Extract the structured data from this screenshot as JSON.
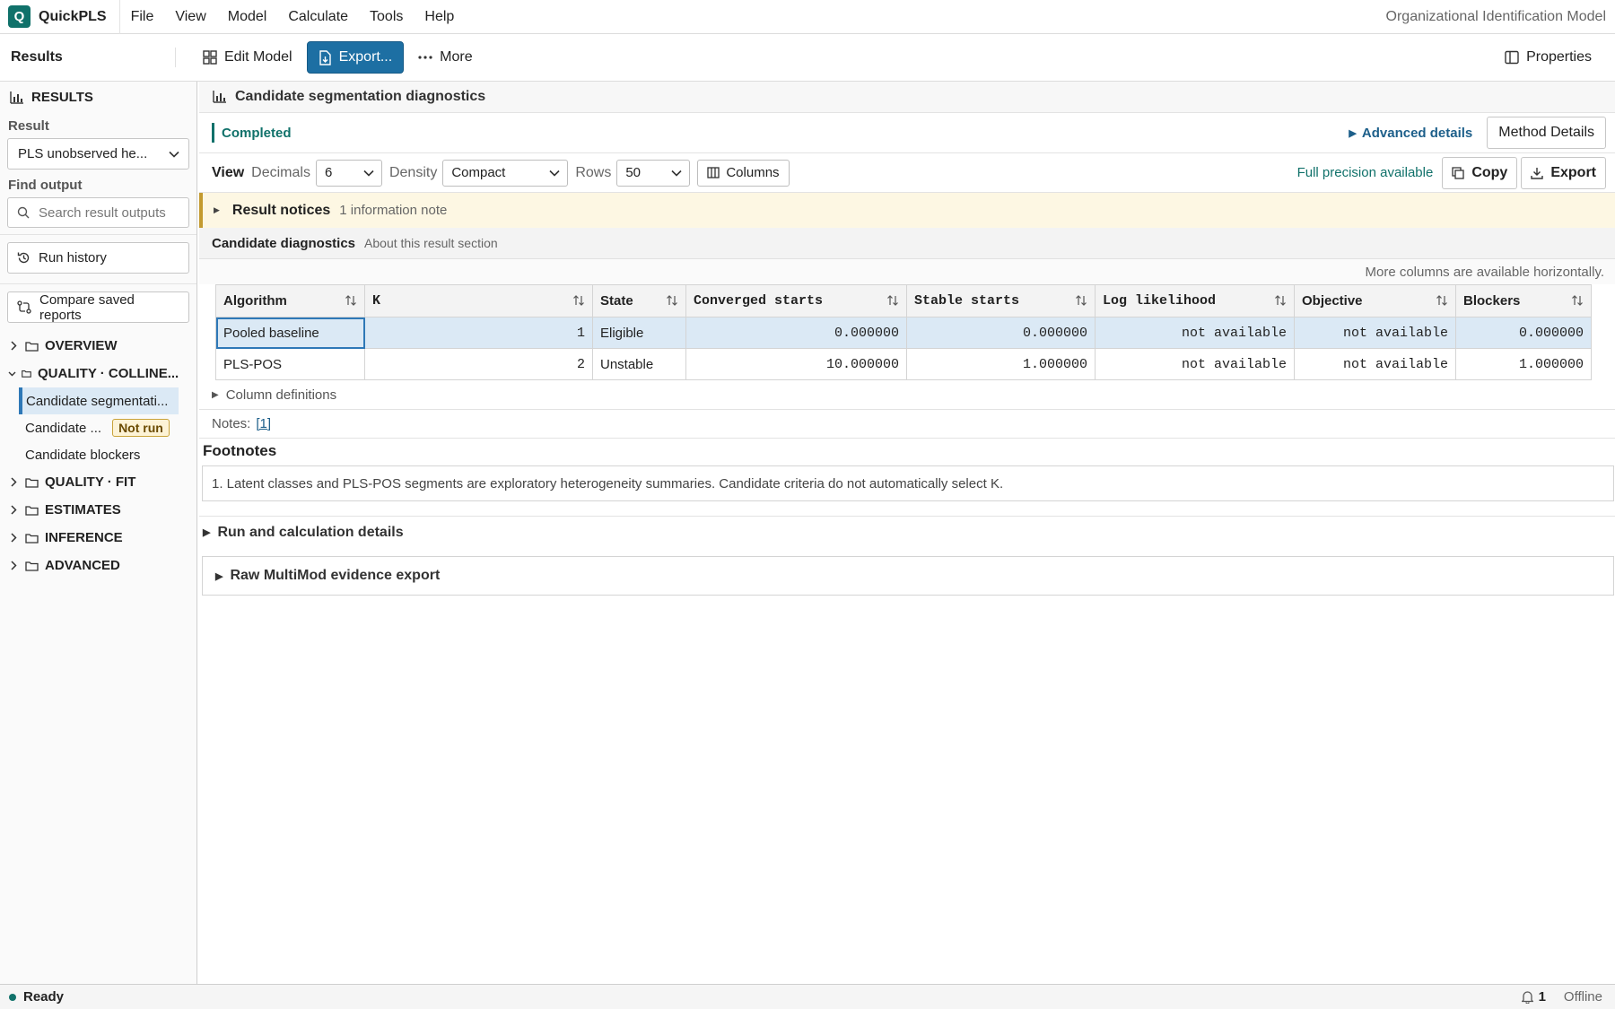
{
  "app": {
    "name": "QuickPLS",
    "logo_letter": "Q",
    "model_name": "Organizational Identification Model"
  },
  "menu": [
    "File",
    "View",
    "Model",
    "Calculate",
    "Tools",
    "Help"
  ],
  "toolbar": {
    "title": "Results",
    "edit_model": "Edit Model",
    "export": "Export...",
    "more": "More",
    "properties": "Properties"
  },
  "sidebar": {
    "heading": "RESULTS",
    "result_label": "Result",
    "result_value": "PLS unobserved he...",
    "find_label": "Find output",
    "search_placeholder": "Search result outputs",
    "run_history": "Run history",
    "compare_reports": "Compare saved reports",
    "groups": {
      "overview": "OVERVIEW",
      "quality_collinearity": "QUALITY · COLLINE...",
      "quality_fit": "QUALITY · FIT",
      "estimates": "ESTIMATES",
      "inference": "INFERENCE",
      "advanced": "ADVANCED"
    },
    "children": {
      "segmentation": "Candidate segmentati...",
      "candidate": "Candidate ...",
      "candidate_badge": "Not run",
      "blockers": "Candidate blockers"
    }
  },
  "main": {
    "title": "Candidate segmentation diagnostics",
    "status": "Completed",
    "advanced_details": "Advanced details",
    "method_details": "Method Details",
    "view": {
      "label": "View",
      "decimals_label": "Decimals",
      "decimals_value": "6",
      "density_label": "Density",
      "density_value": "Compact",
      "rows_label": "Rows",
      "rows_value": "50",
      "columns": "Columns",
      "full_precision": "Full precision available",
      "copy": "Copy",
      "export": "Export"
    },
    "notices": {
      "title": "Result notices",
      "detail": "1 information note"
    },
    "section": {
      "title": "Candidate diagnostics",
      "about": "About this result section"
    },
    "hint": "More columns are available horizontally.",
    "table": {
      "headers": [
        "Algorithm",
        "K",
        "State",
        "Converged starts",
        "Stable starts",
        "Log likelihood",
        "Objective",
        "Blockers"
      ],
      "rows": [
        [
          "Pooled baseline",
          "1",
          "Eligible",
          "0.000000",
          "0.000000",
          "not available",
          "not available",
          "0.000000"
        ],
        [
          "PLS-POS",
          "2",
          "Unstable",
          "10.000000",
          "1.000000",
          "not available",
          "not available",
          "1.000000"
        ]
      ]
    },
    "column_definitions": "Column definitions",
    "notes_label": "Notes:",
    "notes_ref": "[1]",
    "footnotes_title": "Footnotes",
    "footnote_1": "1. Latent classes and PLS-POS segments are exploratory heterogeneity summaries. Candidate criteria do not automatically select K.",
    "run_details": "Run and calculation details",
    "raw_export": "Raw MultiMod evidence export"
  },
  "statusbar": {
    "ready": "Ready",
    "notifications": "1",
    "connection": "Offline"
  },
  "colors": {
    "brand": "#10716a",
    "primary": "#1d6fa3",
    "selection": "#dbe9f5",
    "warning_bg": "#fdf7e3"
  }
}
